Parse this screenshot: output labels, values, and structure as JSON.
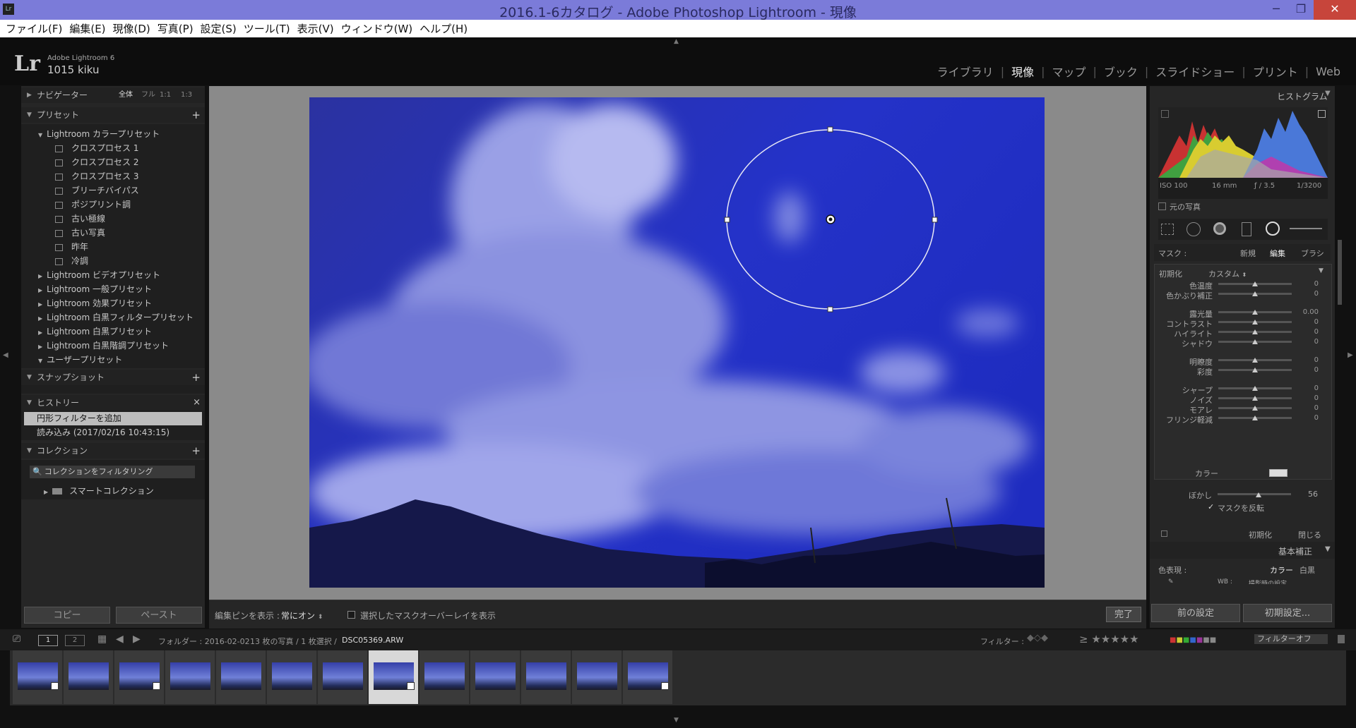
{
  "window": {
    "title": "2016.1-6カタログ - Adobe Photoshop Lightroom - 現像",
    "app_icon": "Lr",
    "minimize_icon": "─",
    "maximize_icon": "❐",
    "close_icon": "✕"
  },
  "menu": [
    "ファイル(F)",
    "編集(E)",
    "現像(D)",
    "写真(P)",
    "設定(S)",
    "ツール(T)",
    "表示(V)",
    "ウィンドウ(W)",
    "ヘルプ(H)"
  ],
  "identity": {
    "logo": "Lr",
    "app_name": "Adobe Lightroom 6",
    "catalog_name": "1015 kiku"
  },
  "modules": [
    {
      "label": "ライブラリ",
      "active": false
    },
    {
      "label": "現像",
      "active": true
    },
    {
      "label": "マップ",
      "active": false
    },
    {
      "label": "ブック",
      "active": false
    },
    {
      "label": "スライドショー",
      "active": false
    },
    {
      "label": "プリント",
      "active": false
    },
    {
      "label": "Web",
      "active": false
    }
  ],
  "navigator": {
    "title": "ナビゲーター",
    "zoom_options": [
      "全体",
      "フル",
      "1:1",
      "1:3"
    ],
    "zoom_selected": "全体"
  },
  "presets": {
    "title": "プリセット",
    "add": "+",
    "groups": [
      {
        "label": "Lightroom カラープリセット",
        "expanded": true,
        "items": [
          "クロスプロセス 1",
          "クロスプロセス 2",
          "クロスプロセス 3",
          "ブリーチバイパス",
          "ポジプリント調",
          "古い極線",
          "古い写真",
          "昨年",
          "冷調"
        ]
      },
      {
        "label": "Lightroom ビデオプリセット",
        "expanded": false
      },
      {
        "label": "Lightroom 一般プリセット",
        "expanded": false
      },
      {
        "label": "Lightroom 効果プリセット",
        "expanded": false
      },
      {
        "label": "Lightroom 白黒フィルタープリセット",
        "expanded": false
      },
      {
        "label": "Lightroom 白黒プリセット",
        "expanded": false
      },
      {
        "label": "Lightroom 白黒階調プリセット",
        "expanded": false
      },
      {
        "label": "ユーザープリセット",
        "expanded": true
      }
    ]
  },
  "snapshots": {
    "title": "スナップショット",
    "add": "+"
  },
  "history": {
    "title": "ヒストリー",
    "clear": "×",
    "items": [
      "円形フィルターを追加",
      "読み込み (2017/02/16 10:43:15)"
    ]
  },
  "collections": {
    "title": "コレクション",
    "add": "+",
    "filter_placeholder": "コレクションをフィルタリング",
    "items": [
      "スマートコレクション"
    ]
  },
  "left_buttons": {
    "copy": "コピー",
    "paste": "ペースト"
  },
  "toolbar": {
    "edit_pins_label": "編集ピンを表示 :",
    "edit_pins_value": "常にオン",
    "overlay_label": "選択したマスクオーバーレイを表示",
    "done": "完了"
  },
  "histogram": {
    "title": "ヒストグラム",
    "iso": "ISO 100",
    "focal": "16 mm",
    "aperture": "ƒ / 3.5",
    "shutter": "1/3200",
    "original_photo": "元の写真"
  },
  "mask": {
    "label": "マスク :",
    "new": "新規",
    "edit": "編集",
    "brush": "ブラシ"
  },
  "effect": {
    "label": "初期化",
    "value": "カスタム"
  },
  "sliders": [
    {
      "label": "色温度",
      "value": "0",
      "pos": 0.5
    },
    {
      "label": "色かぶり補正",
      "value": "0",
      "pos": 0.5
    },
    {
      "label": "露光量",
      "value": "0.00",
      "pos": 0.5
    },
    {
      "label": "コントラスト",
      "value": "0",
      "pos": 0.5
    },
    {
      "label": "ハイライト",
      "value": "0",
      "pos": 0.5
    },
    {
      "label": "シャドウ",
      "value": "0",
      "pos": 0.5
    },
    {
      "label": "明瞭度",
      "value": "0",
      "pos": 0.5
    },
    {
      "label": "彩度",
      "value": "0",
      "pos": 0.5
    },
    {
      "label": "シャープ",
      "value": "0",
      "pos": 0.5
    },
    {
      "label": "ノイズ",
      "value": "0",
      "pos": 0.5
    },
    {
      "label": "モアレ",
      "value": "0",
      "pos": 0.5
    },
    {
      "label": "フリンジ軽減",
      "value": "0",
      "pos": 0.5
    }
  ],
  "color_label": "カラー",
  "feather": {
    "label": "ぼかし",
    "value": "56",
    "pos": 0.56
  },
  "invert_mask": {
    "label": "マスクを反転",
    "checked": true
  },
  "mask_footer": {
    "reset": "初期化",
    "close": "閉じる"
  },
  "basic": {
    "title": "基本補正",
    "treatment_label": "色表現 :",
    "color": "カラー",
    "bw": "白黒",
    "wb_label": "WB :",
    "wb_value": "撮影時の設定"
  },
  "right_buttons": {
    "previous": "前の設定",
    "reset": "初期設定..."
  },
  "filmstrip_bar": {
    "page1": "1",
    "page2": "2",
    "source": "フォルダー : 2016-02-02",
    "count": "13 枚の写真 / 1 枚選択 /",
    "filename": "DSC05369.ARW",
    "filter_label": "フィルター :",
    "filter_value": "フィルターオフ"
  },
  "thumbs": [
    {
      "badge": true,
      "selected": false
    },
    {
      "badge": false,
      "selected": false
    },
    {
      "badge": true,
      "selected": false
    },
    {
      "badge": false,
      "selected": false
    },
    {
      "badge": false,
      "selected": false
    },
    {
      "badge": false,
      "selected": false
    },
    {
      "badge": false,
      "selected": false
    },
    {
      "badge": true,
      "selected": true
    },
    {
      "badge": false,
      "selected": false
    },
    {
      "badge": false,
      "selected": false
    },
    {
      "badge": false,
      "selected": false
    },
    {
      "badge": false,
      "selected": false
    },
    {
      "badge": true,
      "selected": false
    }
  ],
  "colors": {
    "accent": "#7b7bd9",
    "panel": "#262626",
    "close": "#c7453b"
  }
}
